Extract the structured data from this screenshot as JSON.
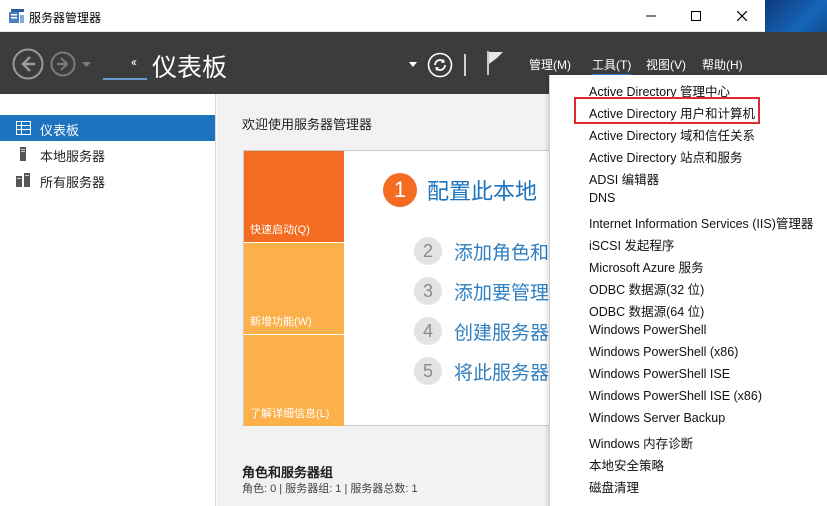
{
  "window": {
    "title": "服务器管理器"
  },
  "header": {
    "page_title": "仪表板",
    "breadcrumb_arrow": "‹‹",
    "menus": [
      {
        "label": "管理(M)"
      },
      {
        "label": "工具(T)"
      },
      {
        "label": "视图(V)"
      },
      {
        "label": "帮助(H)"
      }
    ]
  },
  "sidebar": {
    "items": [
      {
        "label": "仪表板",
        "icon": "dashboard-icon",
        "active": true
      },
      {
        "label": "本地服务器",
        "icon": "server-icon"
      },
      {
        "label": "所有服务器",
        "icon": "servers-icon"
      }
    ]
  },
  "main": {
    "welcome": "欢迎使用服务器管理器",
    "tiles": [
      {
        "label": "快速启动(Q)",
        "color": "#f36c21"
      },
      {
        "label": "新增功能(W)",
        "color": "#fbb04a"
      },
      {
        "label": "了解详细信息(L)",
        "color": "#fbb04a"
      }
    ],
    "steps": [
      {
        "num": "1",
        "text": "配置此本地"
      },
      {
        "num": "2",
        "text": "添加角色和"
      },
      {
        "num": "3",
        "text": "添加要管理"
      },
      {
        "num": "4",
        "text": "创建服务器"
      },
      {
        "num": "5",
        "text": "将此服务器"
      }
    ],
    "roles_title": "角色和服务器组",
    "roles_summary": "角色: 0 | 服务器组: 1 | 服务器总数: 1"
  },
  "tools_menu": {
    "items": [
      "Active Directory 管理中心",
      "Active Directory 用户和计算机",
      "Active Directory 域和信任关系",
      "Active Directory 站点和服务",
      "ADSI 编辑器",
      "DNS",
      "Internet Information Services (IIS)管理器",
      "iSCSI 发起程序",
      "Microsoft Azure 服务",
      "ODBC 数据源(32 位)",
      "ODBC 数据源(64 位)",
      "Windows PowerShell",
      "Windows PowerShell (x86)",
      "Windows PowerShell ISE",
      "Windows PowerShell ISE (x86)",
      "Windows Server Backup",
      "Windows 内存诊断",
      "本地安全策略",
      "磁盘清理"
    ],
    "highlighted_index": 1,
    "highlight_color": "#e0292e"
  },
  "colors": {
    "header_bg": "#3c3c3c",
    "accent": "#1e73be",
    "orange": "#f36c21",
    "light_orange": "#fbb04a"
  }
}
